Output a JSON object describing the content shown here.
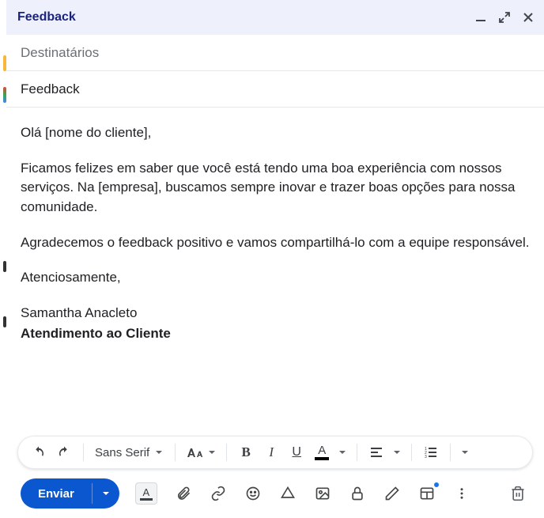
{
  "titlebar": {
    "title": "Feedback"
  },
  "compose": {
    "recipients_placeholder": "Destinatários",
    "subject": "Feedback",
    "body": {
      "greeting": "Olá [nome do cliente],",
      "p1": "Ficamos felizes em saber que você está tendo uma boa experiência com nossos serviços. Na [empresa], buscamos sempre inovar e trazer boas opções para nossa comunidade.",
      "p2": "Agradecemos o feedback positivo e vamos compartilhá-lo com a equipe responsável.",
      "closing": "Atenciosamente,",
      "signature_name": "Samantha Anacleto",
      "signature_role": "Atendimento ao Cliente"
    }
  },
  "format_toolbar": {
    "font_family": "Sans Serif"
  },
  "actions": {
    "send_label": "Enviar"
  },
  "colors": {
    "primary": "#0b57d0",
    "header_bg": "#eef1fb"
  }
}
